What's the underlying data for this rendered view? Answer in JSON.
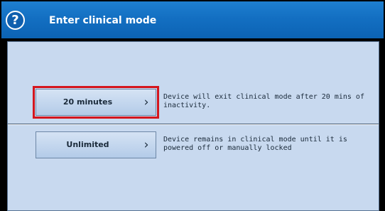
{
  "dialog": {
    "title": "Enter clinical mode",
    "help_icon_glyph": "?"
  },
  "options": [
    {
      "label": "20 minutes",
      "description": "Device will exit clinical mode after 20 mins of inactivity.",
      "selected": true
    },
    {
      "label": "Unlimited",
      "description": "Device remains in clinical mode until it is powered off or manually locked",
      "selected": false
    }
  ],
  "icons": {
    "chevron": "›"
  },
  "colors": {
    "title_bar": "#136fc2",
    "panel_background": "#c8d9ef",
    "selection_highlight": "#d4161e"
  }
}
